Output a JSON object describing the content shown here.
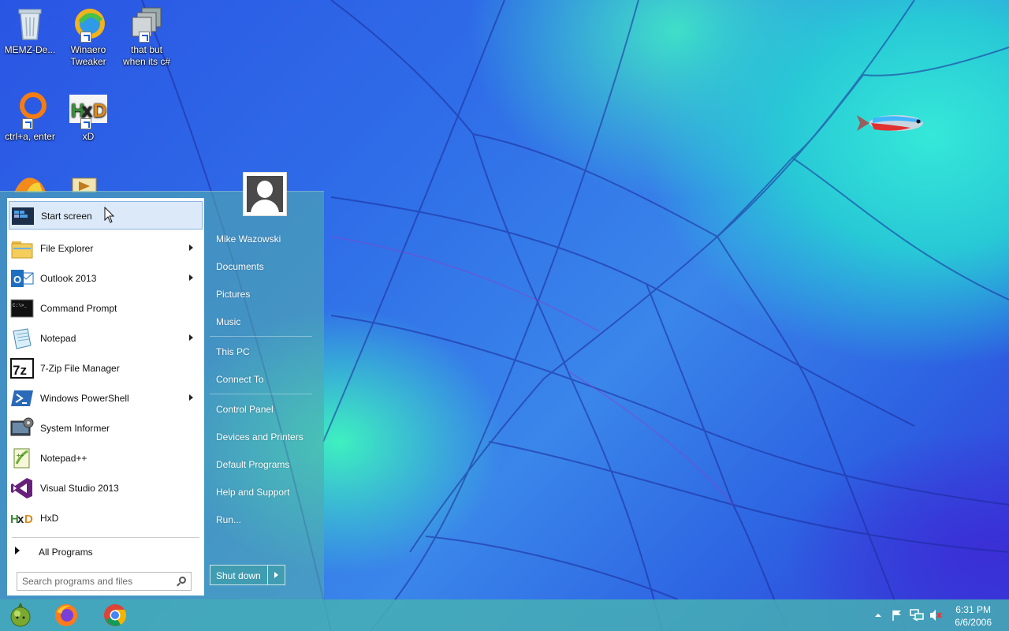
{
  "desktop": {
    "icons": [
      {
        "label": "MEMZ-De...",
        "icon": "recycle-bin-icon"
      },
      {
        "label": "Winaero Tweaker",
        "icon": "winaero-icon"
      },
      {
        "label": "that but when its c#",
        "icon": "stacked-windows-icon"
      },
      {
        "label": "ctrl+a, enter",
        "icon": "orange-ring-icon"
      },
      {
        "label": "xD",
        "icon": "hxd-icon"
      }
    ]
  },
  "start_menu": {
    "programs": [
      {
        "label": "Start screen",
        "has_submenu": false,
        "highlighted": true
      },
      {
        "label": "File Explorer",
        "has_submenu": true
      },
      {
        "label": "Outlook 2013",
        "has_submenu": true
      },
      {
        "label": "Command Prompt",
        "has_submenu": false
      },
      {
        "label": "Notepad",
        "has_submenu": true
      },
      {
        "label": "7-Zip File Manager",
        "has_submenu": false
      },
      {
        "label": "Windows PowerShell",
        "has_submenu": true
      },
      {
        "label": "System Informer",
        "has_submenu": false
      },
      {
        "label": "Notepad++",
        "has_submenu": false
      },
      {
        "label": "Visual Studio 2013",
        "has_submenu": false
      },
      {
        "label": "HxD",
        "has_submenu": false
      }
    ],
    "all_programs": "All Programs",
    "search_placeholder": "Search programs and files",
    "right_items": [
      "Mike Wazowski",
      "Documents",
      "Pictures",
      "Music",
      "This PC",
      "Connect To",
      "Control Panel",
      "Devices and Printers",
      "Default Programs",
      "Help and Support",
      "Run..."
    ],
    "shutdown_label": "Shut down"
  },
  "taskbar": {
    "pinned": [
      "start-orb-icon",
      "firefox-icon",
      "chrome-icon"
    ],
    "tray": [
      "show-hidden-icons-chevron",
      "action-center-flag-icon",
      "network-icon",
      "volume-muted-icon"
    ],
    "time": "6:31 PM",
    "date": "6/6/2006"
  },
  "colors": {
    "taskbar": "#46afb4",
    "highlight": "#dbe9f8",
    "highlight_border": "#8db4e2"
  }
}
